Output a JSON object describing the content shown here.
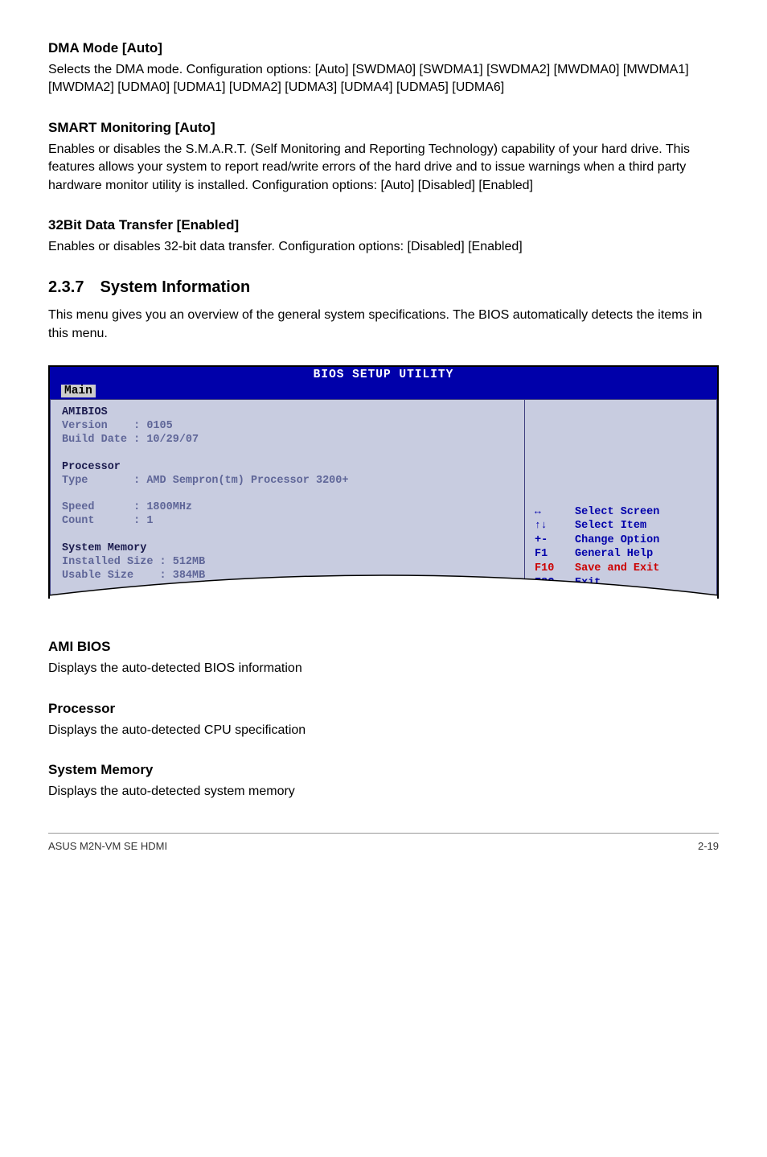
{
  "sections": {
    "dma": {
      "heading": "DMA Mode [Auto]",
      "body": "Selects the DMA mode. Configuration options: [Auto] [SWDMA0] [SWDMA1] [SWDMA2] [MWDMA0] [MWDMA1] [MWDMA2] [UDMA0] [UDMA1] [UDMA2] [UDMA3] [UDMA4] [UDMA5] [UDMA6]"
    },
    "smart": {
      "heading": "SMART Monitoring [Auto]",
      "body": "Enables or disables the S.M.A.R.T. (Self Monitoring and Reporting Technology) capability of your hard drive. This features allows your system to report read/write errors of the hard drive and to issue warnings when a third party hardware monitor utility is installed. Configuration options: [Auto] [Disabled] [Enabled]"
    },
    "bit32": {
      "heading": "32Bit Data Transfer [Enabled]",
      "body": "Enables or disables 32-bit data transfer. Configuration options: [Disabled] [Enabled]"
    },
    "sysinfo": {
      "heading": "2.3.7 System Information",
      "body": "This menu gives you an overview of the general system specifications. The BIOS automatically detects the items in this menu."
    },
    "amibios": {
      "heading": "AMI BIOS",
      "body": "Displays the auto-detected BIOS information"
    },
    "processor": {
      "heading": "Processor",
      "body": "Displays the auto-detected CPU specification"
    },
    "sysmem": {
      "heading": "System Memory",
      "body": "Displays the auto-detected system memory"
    }
  },
  "bios": {
    "title": "BIOS SETUP UTILITY",
    "tab": "Main",
    "left": {
      "amibios_label": "AMIBIOS",
      "version_label": "Version",
      "version_value": ": 0105",
      "builddate_label": "Build Date",
      "builddate_value": ": 10/29/07",
      "processor_label": "Processor",
      "type_label": "Type",
      "type_value": ": AMD Sempron(tm) Processor 3200+",
      "speed_label": "Speed",
      "speed_value": ": 1800MHz",
      "count_label": "Count",
      "count_value": ": 1",
      "sysmem_label": "System Memory",
      "installed_label": "Installed Size",
      "installed_value": ": 512MB",
      "usable_label": "Usable Size",
      "usable_value": ": 384MB"
    },
    "help": [
      {
        "key": "↔",
        "text": "Select Screen"
      },
      {
        "key": "↑↓",
        "text": "Select Item"
      },
      {
        "key": "+-",
        "text": "Change Option"
      },
      {
        "key": "F1",
        "text": "General Help"
      },
      {
        "key": "F10",
        "text": "Save and Exit"
      },
      {
        "key": "ESC",
        "text": "Exit"
      }
    ]
  },
  "footer": {
    "left": "ASUS M2N-VM SE HDMI",
    "right": "2-19"
  }
}
